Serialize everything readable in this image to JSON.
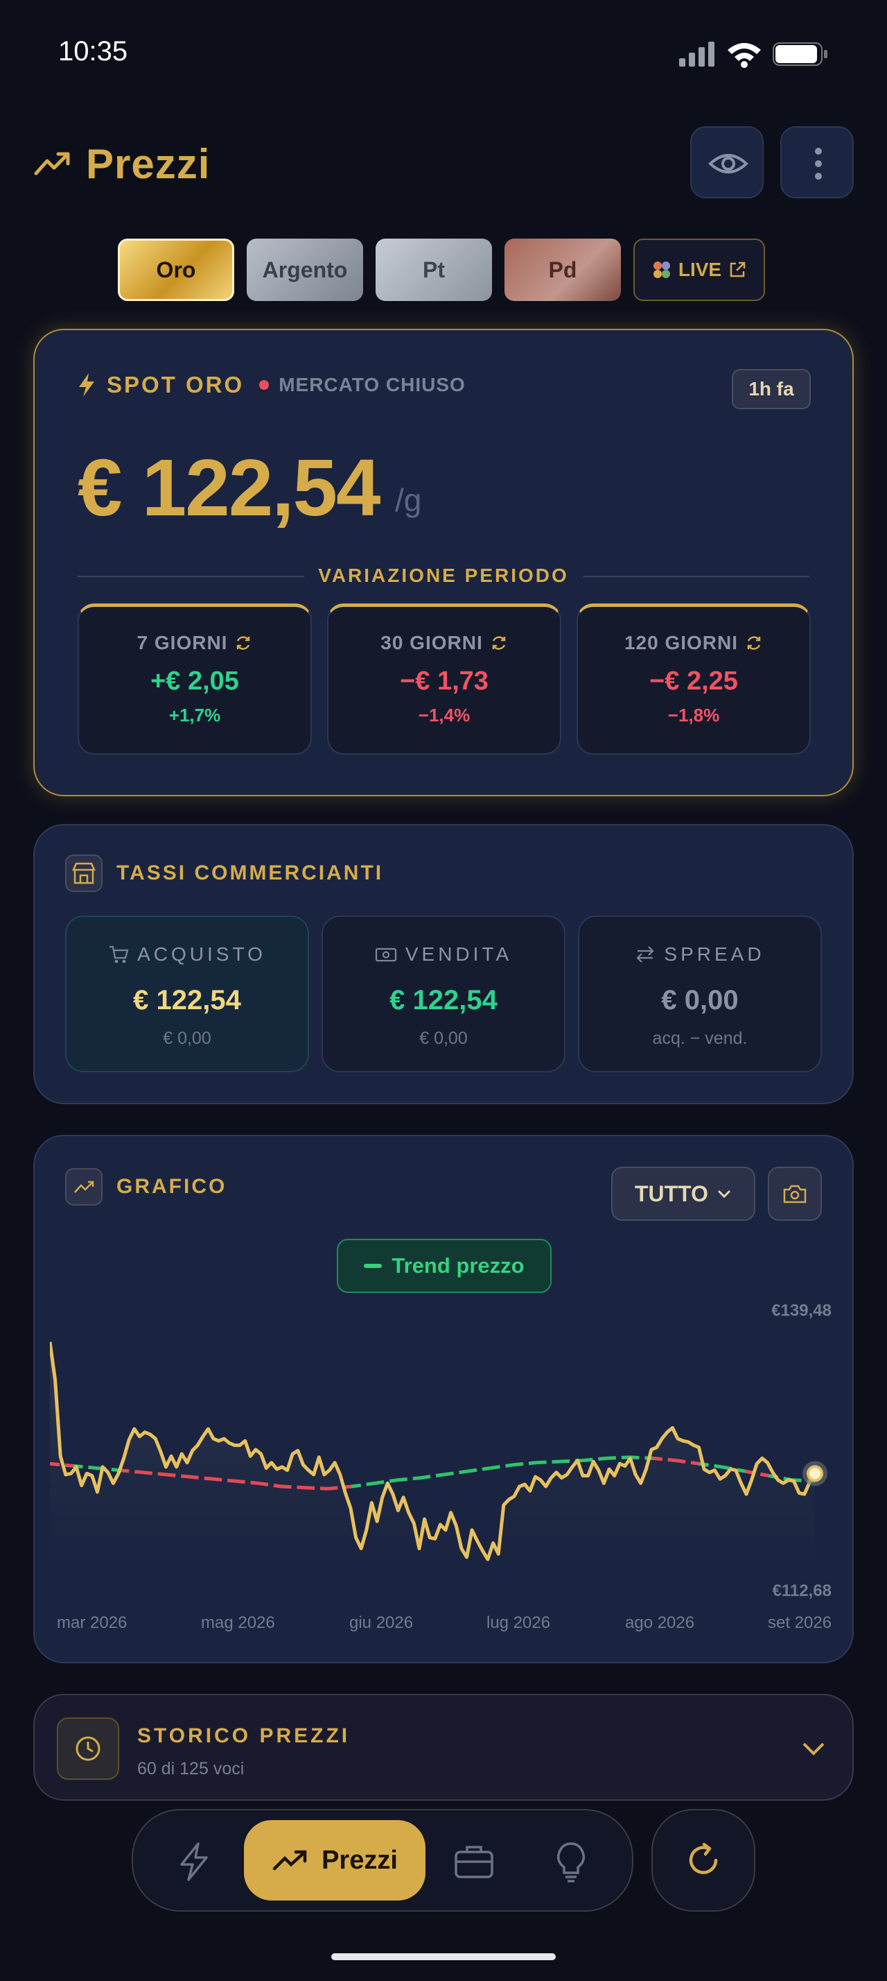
{
  "status_bar": {
    "time": "10:35"
  },
  "header": {
    "title": "Prezzi"
  },
  "metals": {
    "oro": "Oro",
    "argento": "Argento",
    "pt": "Pt",
    "pd": "Pd",
    "live": "LIVE"
  },
  "spot": {
    "title": "SPOT ORO",
    "market_status": "MERCATO CHIUSO",
    "updated": "1h fa",
    "price": "€ 122,54",
    "unit": "/g",
    "variation_label": "VARIAZIONE PERIODO",
    "periods": [
      {
        "label": "7 GIORNI",
        "value": "+€ 2,05",
        "pct": "+1,7%"
      },
      {
        "label": "30 GIORNI",
        "value": "−€ 1,73",
        "pct": "−1,4%"
      },
      {
        "label": "120 GIORNI",
        "value": "−€ 2,25",
        "pct": "−1,8%"
      }
    ]
  },
  "rates": {
    "title": "TASSI COMMERCIANTI",
    "buy": {
      "label": "ACQUISTO",
      "value": "€ 122,54",
      "sub": "€ 0,00"
    },
    "sell": {
      "label": "VENDITA",
      "value": "€ 122,54",
      "sub": "€ 0,00"
    },
    "spread": {
      "label": "SPREAD",
      "value": "€ 0,00",
      "sub": "acq. − vend."
    }
  },
  "chart_section": {
    "title": "GRAFICO",
    "range": "TUTTO",
    "trend_label": "Trend prezzo"
  },
  "chart_data": {
    "type": "line",
    "ylim": [
      112.68,
      139.48
    ],
    "y_labels": [
      "€139,48",
      "€112,68"
    ],
    "x_labels": [
      "mar 2026",
      "mag 2026",
      "giu 2026",
      "lug 2026",
      "ago 2026",
      "set 2026"
    ],
    "series": [
      {
        "values": [
          136.5,
          133,
          126,
          124.3,
          124.4,
          125,
          123.3,
          124.4,
          124.2,
          122.7,
          125,
          124.5,
          123.5,
          124.4,
          125.8,
          127.5,
          128.5,
          127.8,
          128.2,
          128,
          127.6,
          126.4,
          125,
          126,
          125,
          126.2,
          125.4,
          126.5,
          127,
          127.8,
          128.5,
          127.6,
          127.4,
          127.6,
          127.2,
          127,
          127,
          127.4,
          126,
          126.6,
          126.2,
          124.9,
          125.4,
          124.8,
          125,
          124.7,
          126.2,
          126.5,
          125.2,
          124.7,
          124.3,
          125.9,
          124.3,
          124.7,
          125.4,
          124.3,
          122.6,
          121.2,
          118.5,
          117.5,
          119.2,
          121.7,
          120,
          122.2,
          123.5,
          122.5,
          121,
          122.2,
          120.8,
          119.8,
          117.5,
          120.2,
          118.5,
          118.4,
          119.7,
          119.2,
          120.8,
          119.6,
          117.5,
          116.7,
          119.2,
          118.2,
          117.3,
          116.5,
          118,
          117,
          121.5,
          122,
          122.3,
          123.2,
          123.4,
          122.8,
          124.1,
          123.8,
          123.2,
          124,
          124.5,
          124,
          124.3,
          125,
          125.6,
          124.2,
          124.2,
          125.5,
          124.7,
          123.5,
          124.8,
          124.2,
          125.3,
          125.1,
          125.8,
          124.3,
          123.5,
          124.8,
          126.6,
          126.8,
          127.6,
          128.2,
          128.6,
          127.6,
          127.4,
          127.3,
          127,
          126.8,
          124.8,
          124.5,
          124.7,
          123.9,
          124.2,
          124.8,
          124.7,
          123.5,
          122.5,
          123.8,
          125.3,
          125.8,
          125.4,
          124.5,
          123.8,
          123.5,
          123.8,
          123.7,
          122.6,
          122.5,
          123.6,
          124.4
        ]
      },
      {
        "values": [
          125.3,
          125.1,
          124.9,
          124.7,
          124.5,
          124.3,
          124.1,
          123.9,
          123.7,
          123.5,
          123.2,
          123.1,
          123.0,
          123.2,
          123.5,
          123.8,
          124.0,
          124.3,
          124.6,
          124.9,
          125.2,
          125.4,
          125.5,
          125.6,
          125.8,
          125.9,
          125.8,
          125.6,
          125.3,
          125.0,
          124.6,
          124.2,
          123.8,
          123.7
        ]
      }
    ]
  },
  "history": {
    "title": "STORICO PREZZI",
    "subtitle": "60 di 125 voci"
  },
  "nav": {
    "active_label": "Prezzi"
  }
}
